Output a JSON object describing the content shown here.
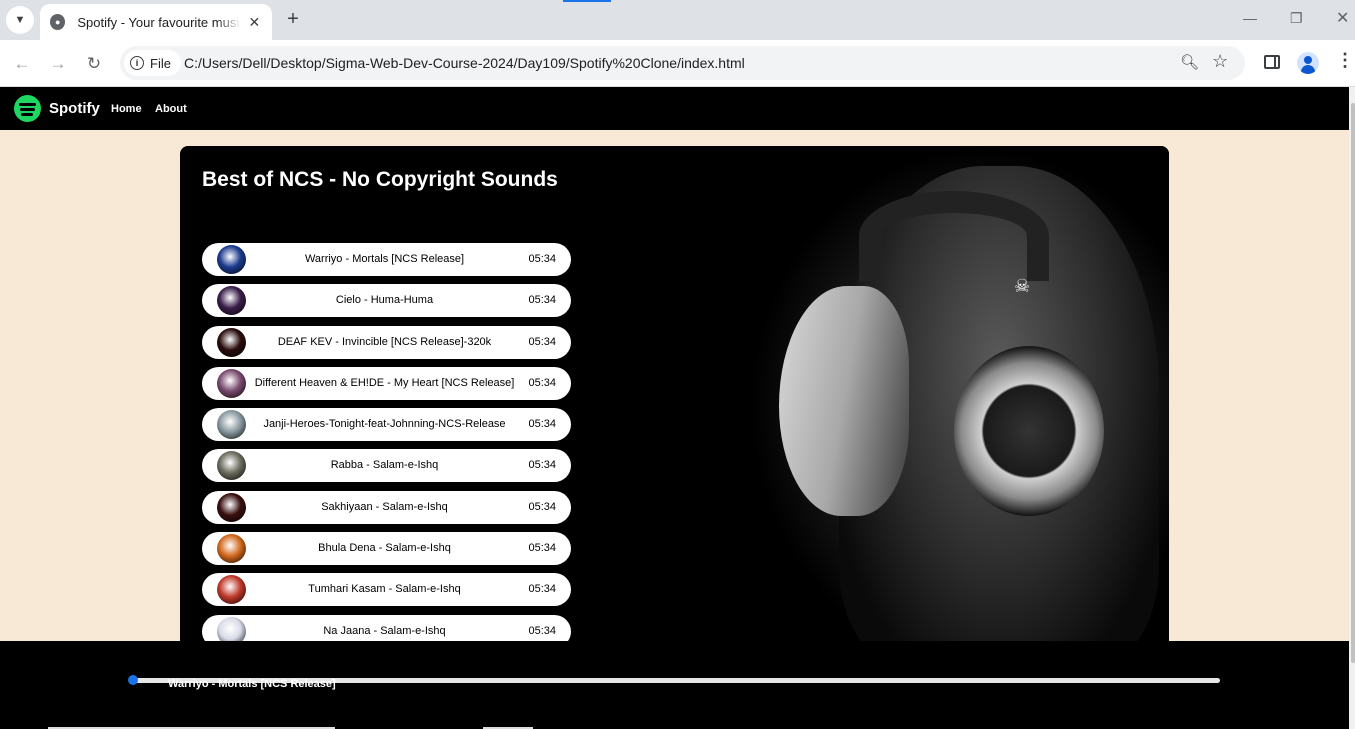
{
  "browser": {
    "tab_title": "Spotify - Your favourite music is here",
    "site_info_label": "File",
    "url": "C:/Users/Dell/Desktop/Sigma-Web-Dev-Course-2024/Day109/Spotify%20Clone/index.html",
    "new_tab": "+",
    "tab_close": "✕"
  },
  "navbar": {
    "brand": "Spotify",
    "links": [
      "Home",
      "About"
    ]
  },
  "playlist": {
    "title": "Best of NCS - No Copyright Sounds",
    "songs": [
      {
        "name": "Warriyo - Mortals [NCS Release]",
        "duration": "05:34",
        "art_color": "#1d3c8f"
      },
      {
        "name": "Cielo - Huma-Huma",
        "duration": "05:34",
        "art_color": "#3a1e4a"
      },
      {
        "name": "DEAF KEV - Invincible [NCS Release]-320k",
        "duration": "05:34",
        "art_color": "#2a0d0d"
      },
      {
        "name": "Different Heaven & EH!DE - My Heart [NCS Release]",
        "duration": "05:34",
        "art_color": "#7a4a6e"
      },
      {
        "name": "Janji-Heroes-Tonight-feat-Johnning-NCS-Release",
        "duration": "05:34",
        "art_color": "#8a9aa0"
      },
      {
        "name": "Rabba - Salam-e-Ishq",
        "duration": "05:34",
        "art_color": "#6b6b5e"
      },
      {
        "name": "Sakhiyaan - Salam-e-Ishq",
        "duration": "05:34",
        "art_color": "#3a1010"
      },
      {
        "name": "Bhula Dena - Salam-e-Ishq",
        "duration": "05:34",
        "art_color": "#d2691e"
      },
      {
        "name": "Tumhari Kasam - Salam-e-Ishq",
        "duration": "05:34",
        "art_color": "#c0392b"
      },
      {
        "name": "Na Jaana - Salam-e-Ishq",
        "duration": "05:34",
        "art_color": "#d8dce8"
      }
    ]
  },
  "player": {
    "now_playing": "Warriyo - Mortals [NCS Release]",
    "progress": 0.0
  }
}
